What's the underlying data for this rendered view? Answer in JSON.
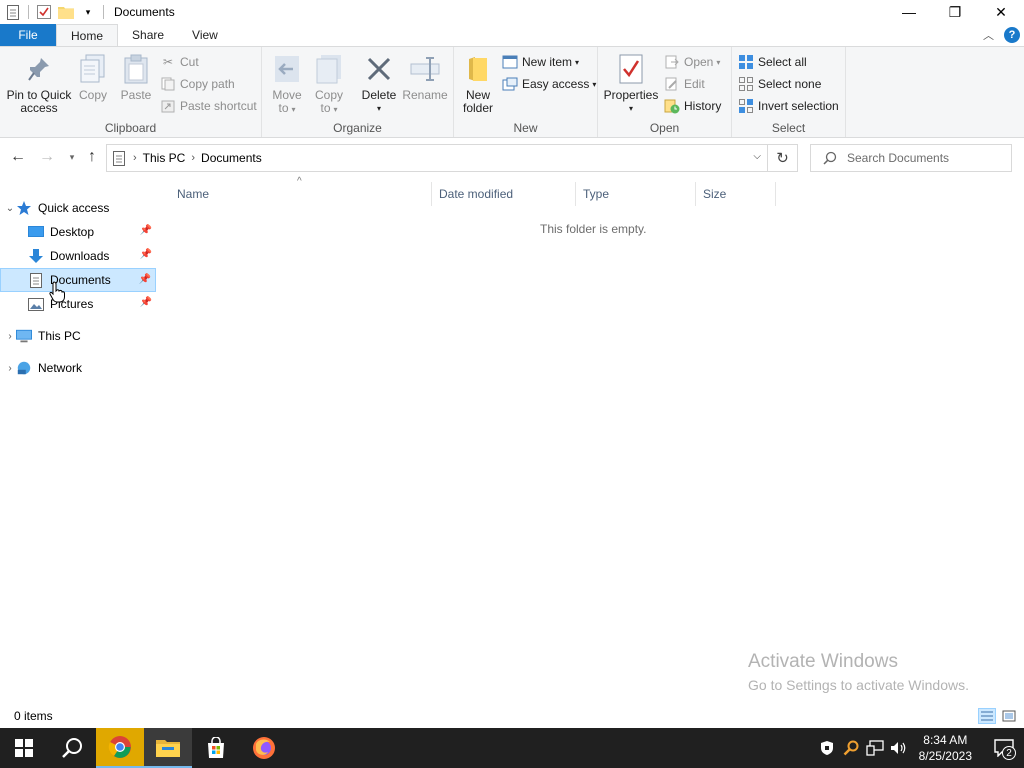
{
  "window": {
    "title": "Documents",
    "controls": {
      "minimize": "—",
      "maximize": "❐",
      "close": "✕"
    }
  },
  "ribbon_tabs": [
    {
      "label": "File"
    },
    {
      "label": "Home"
    },
    {
      "label": "Share"
    },
    {
      "label": "View"
    }
  ],
  "ribbon": {
    "clipboard": {
      "label": "Clipboard",
      "pin": "Pin to Quick access",
      "pin_line1": "Pin to Quick",
      "pin_line2": "access",
      "copy": "Copy",
      "paste": "Paste",
      "cut": "Cut",
      "copy_path": "Copy path",
      "paste_shortcut": "Paste shortcut"
    },
    "organize": {
      "label": "Organize",
      "move_to_line1": "Move",
      "move_to_line2": "to",
      "copy_to_line1": "Copy",
      "copy_to_line2": "to",
      "delete": "Delete",
      "rename": "Rename"
    },
    "new": {
      "label": "New",
      "new_folder_line1": "New",
      "new_folder_line2": "folder",
      "new_item": "New item",
      "easy_access": "Easy access"
    },
    "open": {
      "label": "Open",
      "properties": "Properties",
      "open": "Open",
      "edit": "Edit",
      "history": "History"
    },
    "select": {
      "label": "Select",
      "select_all": "Select all",
      "select_none": "Select none",
      "invert": "Invert selection"
    }
  },
  "address": {
    "crumbs": [
      "This PC",
      "Documents"
    ],
    "search_placeholder": "Search Documents"
  },
  "nav": {
    "quick_access": "Quick access",
    "items": [
      {
        "label": "Desktop"
      },
      {
        "label": "Downloads"
      },
      {
        "label": "Documents"
      },
      {
        "label": "Pictures"
      }
    ],
    "this_pc": "This PC",
    "network": "Network"
  },
  "columns": [
    "Name",
    "Date modified",
    "Type",
    "Size"
  ],
  "empty_message": "This folder is empty.",
  "watermark": {
    "line1": "Activate Windows",
    "line2": "Go to Settings to activate Windows."
  },
  "status": {
    "items": "0 items"
  },
  "taskbar": {
    "time": "8:34 AM",
    "date": "8/25/2023",
    "notifications": "2"
  },
  "colors": {
    "accent": "#1979ca",
    "selection": "#cce8ff",
    "taskbar": "#202020"
  }
}
